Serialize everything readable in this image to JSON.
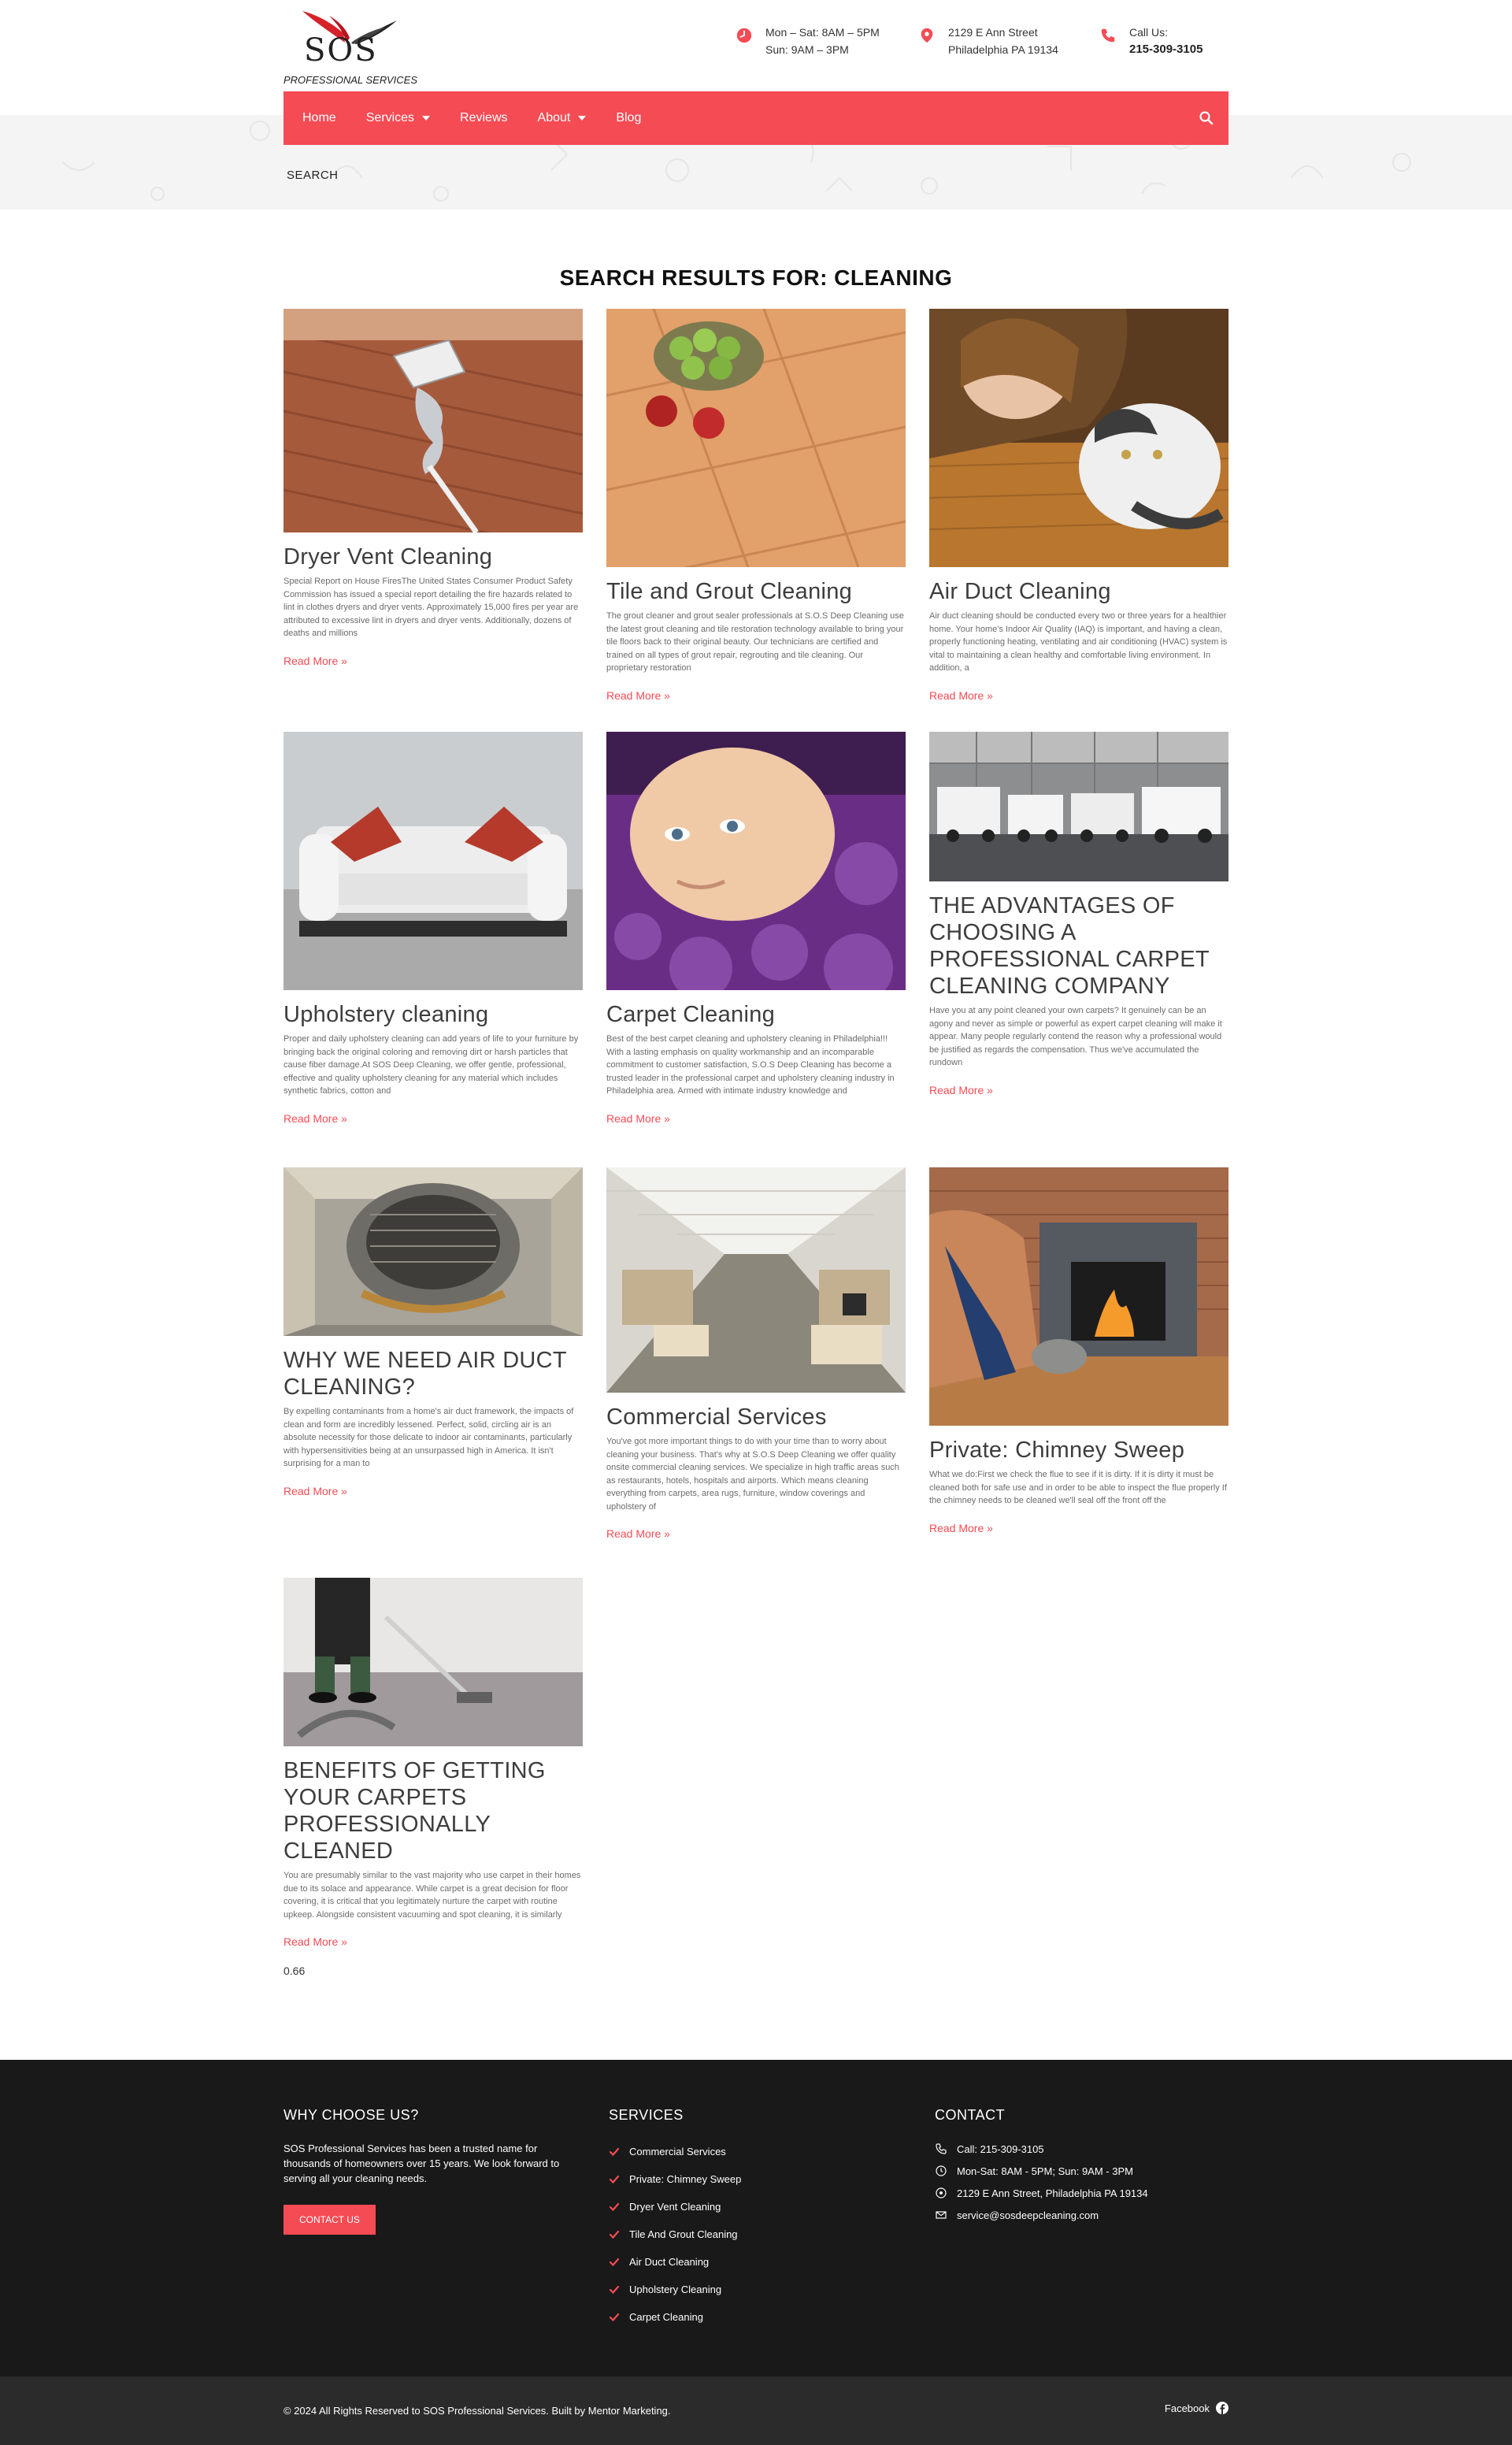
{
  "brand": {
    "logo_text": "SOS",
    "logo_subtitle": "PROFESSIONAL SERVICES",
    "accent_color": "#f54b54"
  },
  "header": {
    "hours_line1": "Mon – Sat: 8AM – 5PM",
    "hours_line2": "Sun: 9AM – 3PM",
    "address_line1": "2129 E Ann Street",
    "address_line2": "Philadelphia PA 19134",
    "call_label": "Call Us:",
    "call_number": "215-309-3105"
  },
  "nav": {
    "items": [
      "Home",
      "Services",
      "Reviews",
      "About",
      "Blog"
    ],
    "search_icon": "search-icon"
  },
  "breadcrumb": "SEARCH",
  "results_title": "SEARCH RESULTS FOR: CLEANING",
  "read_more": "Read More »",
  "posts": [
    {
      "title": "Dryer Vent Cleaning",
      "excerpt": "Special Report on House FiresThe United States Consumer Product Safety Commission has issued a special report detailing the fire hazards related to lint in clothes dryers and dryer vents. Approximately 15,000 fires per year are attributed to excessive lint in dryers and dryer vents. Additionally, dozens of deaths and millions"
    },
    {
      "title": "Tile and Grout Cleaning",
      "excerpt": "The grout cleaner and grout sealer professionals at S.O.S Deep Cleaning use the latest grout cleaning and tile restoration technology available to bring your tile floors back to their original beauty. Our technicians are certified and trained on all types of grout repair, regrouting and tile cleaning. Our proprietary restoration"
    },
    {
      "title": "Air Duct Cleaning",
      "excerpt": "Air duct cleaning should be conducted every two or three years for a healthier home. Your home's Indoor Air Quality (IAQ) is important, and having a clean, properly functioning heating, ventilating and air conditioning (HVAC) system is vital to maintaining a clean healthy and comfortable living environment. In addition, a"
    },
    {
      "title": "Upholstery cleaning",
      "excerpt": "Proper and daily upholstery cleaning can add years of life to your furniture by bringing back the original coloring and removing dirt or harsh particles that cause fiber damage.At SOS Deep Cleaning, we offer gentle, professional, effective and quality upholstery cleaning for any material which includes synthetic fabrics, cotton and"
    },
    {
      "title": "Carpet Cleaning",
      "excerpt": "Best of the best carpet cleaning and upholstery cleaning in Philadelphia!!! With a lasting emphasis on quality workmanship and an incomparable commitment to customer satisfaction, S.O.S Deep Cleaning has become a trusted leader in the professional carpet and upholstery cleaning industry in Philadelphia area. Armed with intimate industry knowledge and"
    },
    {
      "title": "THE ADVANTAGES OF CHOOSING A PROFESSIONAL CARPET CLEANING COMPANY",
      "excerpt": "Have you at any point cleaned your own carpets? It genuinely can be an agony and never as simple or powerful as expert carpet cleaning will make it appear. Many people regularly contend the reason why a professional would be justified as regards the compensation. Thus we've accumulated the rundown"
    },
    {
      "title": "WHY WE NEED AIR DUCT CLEANING?",
      "excerpt": "By expelling contaminants from a home's air duct framework, the impacts of clean and form are incredibly lessened. Perfect, solid, circling air is an absolute necessity for those delicate to indoor air contaminants, particularly with hypersensitivities being at an unsurpassed high in America. It isn't surprising for a man to"
    },
    {
      "title": "Commercial Services",
      "excerpt": "You've got more important things to do with your time than to worry about cleaning your business. That's why at S.O.S Deep Cleaning we offer quality onsite commercial cleaning services. We specialize in high traffic areas such as restaurants, hotels, hospitals and airports. Which means cleaning everything from carpets, area rugs, furniture, window coverings and upholstery of"
    },
    {
      "title": "Private: Chimney Sweep",
      "excerpt": "What we do:First we check the flue to see if it is dirty. If it is dirty it must be cleaned both for safe use and in order to be able to inspect the flue properly If the chimney needs to be cleaned we'll seal off the front off the"
    },
    {
      "title": "BENEFITS OF GETTING YOUR CARPETS PROFESSIONALLY CLEANED",
      "excerpt": "You are presumably similar to the vast majority who use carpet  in  their homes due to its solace and appearance. While carpet is a great decision for floor covering, it is critical that you legitimately nurture the carpet with routine upkeep. Alongside consistent vacuuming and spot cleaning, it is similarly"
    }
  ],
  "stray_value": "0.66",
  "footer": {
    "why_title": "WHY CHOOSE US?",
    "why_text": "SOS Professional Services has been a trusted name for thousands of homeowners over 15 years. We look forward to serving all your cleaning needs.",
    "contact_button": "CONTACT US",
    "services_title": "SERVICES",
    "services": [
      "Commercial Services",
      "Private: Chimney Sweep",
      "Dryer Vent Cleaning",
      "Tile And Grout Cleaning",
      "Air Duct Cleaning",
      "Upholstery Cleaning",
      "Carpet Cleaning"
    ],
    "contact_title": "CONTACT",
    "contact": {
      "call": "Call: 215-309-3105",
      "hours": "Mon-Sat: 8AM - 5PM; Sun: 9AM - 3PM",
      "address": "2129 E Ann Street, Philadelphia PA 19134",
      "email": "service@sosdeepcleaning.com"
    },
    "copyright": "© 2024 All Rights Reserved to SOS Professional Services. Built by Mentor Marketing.",
    "facebook": "Facebook"
  }
}
